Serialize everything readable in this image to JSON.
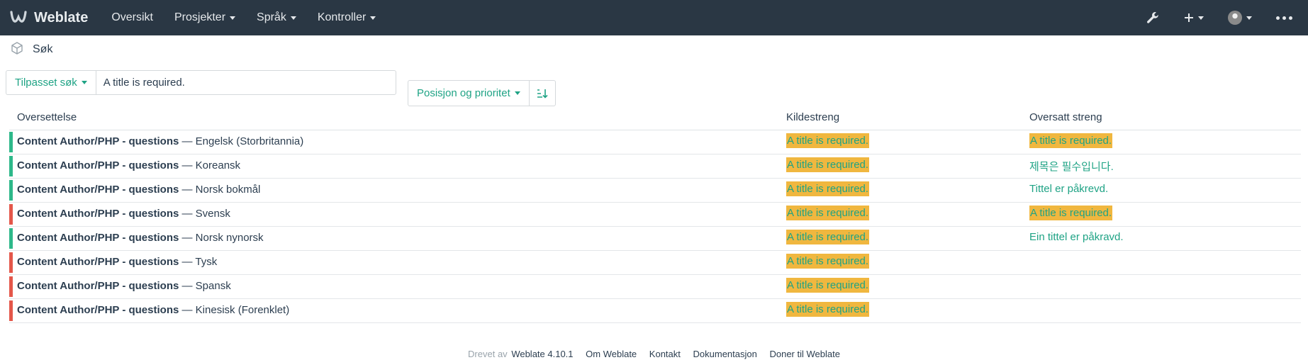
{
  "colors": {
    "navbar": "#2a3744",
    "accent": "#1fa385",
    "highlight": "#f0b73f",
    "translated": "#2eb88a",
    "untranslated": "#e4574a"
  },
  "navbar": {
    "brand": "Weblate",
    "items": [
      {
        "label": "Oversikt",
        "dropdown": false
      },
      {
        "label": "Prosjekter",
        "dropdown": true
      },
      {
        "label": "Språk",
        "dropdown": true
      },
      {
        "label": "Kontroller",
        "dropdown": true
      }
    ],
    "right_icons": [
      "wrench-icon",
      "plus-icon",
      "avatar",
      "more-icon"
    ]
  },
  "breadcrumb": {
    "icon": "cube-icon",
    "label": "Søk"
  },
  "search": {
    "mode_label": "Tilpasset søk",
    "query": "A title is required."
  },
  "sort": {
    "label": "Posisjon og prioritet",
    "direction_icon": "sort-direction-icon"
  },
  "table": {
    "headers": {
      "translation": "Oversettelse",
      "source": "Kildestreng",
      "target": "Oversatt streng"
    },
    "rows": [
      {
        "component": "Content Author/PHP - questions",
        "language": "Engelsk (Storbritannia)",
        "source": "A title is required.",
        "target": "A title is required.",
        "target_highlight": true,
        "status": "translated"
      },
      {
        "component": "Content Author/PHP - questions",
        "language": "Koreansk",
        "source": "A title is required.",
        "target": "제목은 필수입니다.",
        "target_highlight": false,
        "status": "translated"
      },
      {
        "component": "Content Author/PHP - questions",
        "language": "Norsk bokmål",
        "source": "A title is required.",
        "target": "Tittel er påkrevd.",
        "target_highlight": false,
        "status": "translated"
      },
      {
        "component": "Content Author/PHP - questions",
        "language": "Svensk",
        "source": "A title is required.",
        "target": "A title is required.",
        "target_highlight": true,
        "status": "untranslated"
      },
      {
        "component": "Content Author/PHP - questions",
        "language": "Norsk nynorsk",
        "source": "A title is required.",
        "target": "Ein tittel er påkravd.",
        "target_highlight": false,
        "status": "translated"
      },
      {
        "component": "Content Author/PHP - questions",
        "language": "Tysk",
        "source": "A title is required.",
        "target": "",
        "target_highlight": false,
        "status": "untranslated"
      },
      {
        "component": "Content Author/PHP - questions",
        "language": "Spansk",
        "source": "A title is required.",
        "target": "",
        "target_highlight": false,
        "status": "untranslated"
      },
      {
        "component": "Content Author/PHP - questions",
        "language": "Kinesisk (Forenklet)",
        "source": "A title is required.",
        "target": "",
        "target_highlight": false,
        "status": "untranslated"
      }
    ]
  },
  "footer": {
    "powered_by": "Drevet av",
    "version_link": "Weblate 4.10.1",
    "links": [
      "Om Weblate",
      "Kontakt",
      "Dokumentasjon",
      "Doner til Weblate"
    ]
  }
}
